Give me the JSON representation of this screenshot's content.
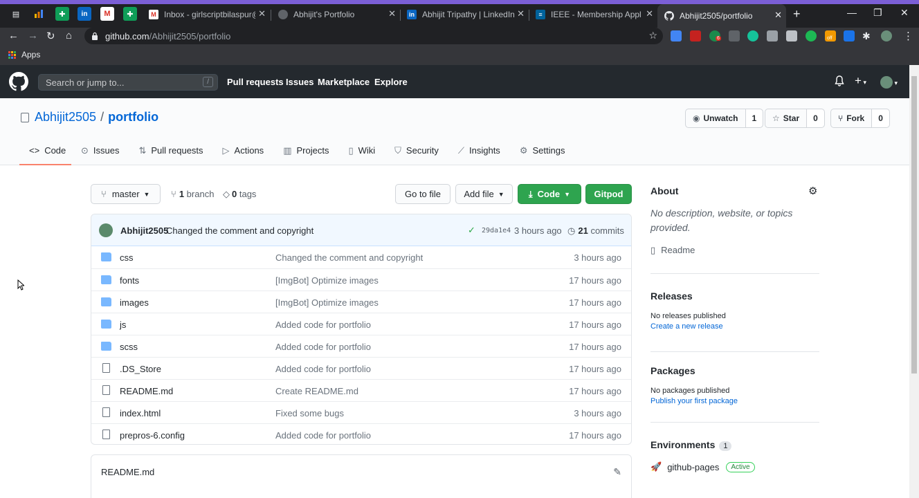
{
  "browser": {
    "tabs": [
      {
        "title": "Inbox - girlscriptbilaspur@g",
        "fav_color": "#d93025",
        "fav_glyph": "M"
      },
      {
        "title": "Abhijit's Portfolio",
        "fav_color": "#5f6368",
        "fav_glyph": "⊕"
      },
      {
        "title": "Abhijit Tripathy | LinkedIn",
        "fav_color": "#0a66c2",
        "fav_glyph": "in"
      },
      {
        "title": "IEEE - Membership Applicati",
        "fav_color": "#00629b",
        "fav_glyph": "≡"
      },
      {
        "title": "Abhijit2505/portfolio",
        "fav_color": "#ffffff",
        "fav_glyph": "●"
      }
    ],
    "new_tab": "+",
    "url_host": "github.com",
    "url_path": "/Abhijit2505/portfolio",
    "bookmarks_apps": "Apps",
    "ext_badge": "6",
    "ext_off": "off"
  },
  "gh": {
    "search_placeholder": "Search or jump to...",
    "slash": "/",
    "nav": [
      "Pull requests",
      "Issues",
      "Marketplace",
      "Explore"
    ]
  },
  "repo": {
    "owner": "Abhijit2505",
    "slash": "/",
    "name": "portfolio",
    "unwatch": "Unwatch",
    "unwatch_count": "1",
    "star": "Star",
    "star_count": "0",
    "fork": "Fork",
    "fork_count": "0",
    "tabs": [
      "Code",
      "Issues",
      "Pull requests",
      "Actions",
      "Projects",
      "Wiki",
      "Security",
      "Insights",
      "Settings"
    ]
  },
  "filenav": {
    "branch": "master",
    "branch_count": "1",
    "branch_label": "branch",
    "tag_count": "0",
    "tag_label": "tags",
    "goto": "Go to file",
    "addfile": "Add file",
    "code": "Code",
    "gitpod": "Gitpod"
  },
  "commit": {
    "author": "Abhijit2505",
    "message": "Changed the comment and copyright",
    "sha": "29da1e4",
    "ago": "3 hours ago",
    "commit_count": "21",
    "commit_label": "commits"
  },
  "files": [
    {
      "name": "css",
      "type": "folder",
      "msg": "Changed the comment and copyright",
      "age": "3 hours ago"
    },
    {
      "name": "fonts",
      "type": "folder",
      "msg": "[ImgBot] Optimize images",
      "age": "17 hours ago"
    },
    {
      "name": "images",
      "type": "folder",
      "msg": "[ImgBot] Optimize images",
      "age": "17 hours ago"
    },
    {
      "name": "js",
      "type": "folder",
      "msg": "Added code for portfolio",
      "age": "17 hours ago"
    },
    {
      "name": "scss",
      "type": "folder",
      "msg": "Added code for portfolio",
      "age": "17 hours ago"
    },
    {
      "name": ".DS_Store",
      "type": "file",
      "msg": "Added code for portfolio",
      "age": "17 hours ago"
    },
    {
      "name": "README.md",
      "type": "file",
      "msg": "Create README.md",
      "age": "17 hours ago"
    },
    {
      "name": "index.html",
      "type": "file",
      "msg": "Fixed some bugs",
      "age": "3 hours ago"
    },
    {
      "name": "prepros-6.config",
      "type": "file",
      "msg": "Added code for portfolio",
      "age": "17 hours ago"
    }
  ],
  "readme": {
    "title": "README.md"
  },
  "sidebar": {
    "about_title": "About",
    "about_desc": "No description, website, or topics provided.",
    "readme": "Readme",
    "releases_title": "Releases",
    "releases_none": "No releases published",
    "releases_link": "Create a new release",
    "packages_title": "Packages",
    "packages_none": "No packages published",
    "packages_link": "Publish your first package",
    "env_title": "Environments",
    "env_count": "1",
    "env_name": "github-pages",
    "env_status": "Active"
  },
  "colors": {
    "accent": "#0366d6",
    "green": "#2ea44f",
    "header": "#24292e",
    "tab_underline": "#f9826c"
  }
}
